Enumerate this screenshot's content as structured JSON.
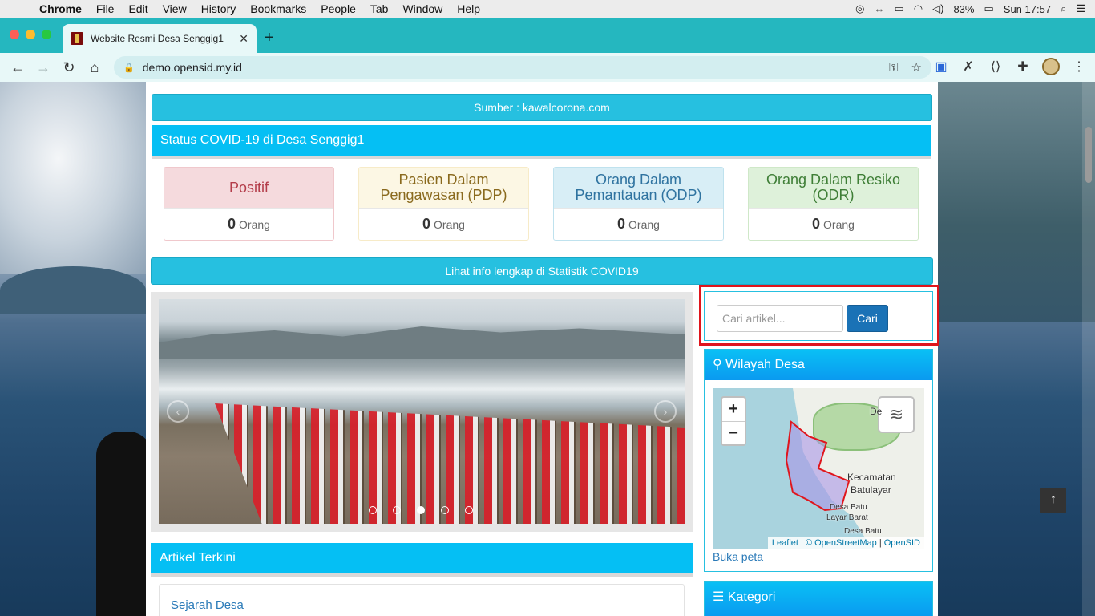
{
  "menubar": {
    "app": "Chrome",
    "items": [
      "File",
      "Edit",
      "View",
      "History",
      "Bookmarks",
      "People",
      "Tab",
      "Window",
      "Help"
    ],
    "battery": "83%",
    "clock": "Sun 17:57"
  },
  "browser": {
    "tab_title": "Website Resmi Desa Senggig1",
    "url": "demo.opensid.my.id"
  },
  "page": {
    "source_bar": "Sumber : kawalcorona.com",
    "covid_title": "Status COVID-19 di Desa Senggig1",
    "stats": [
      {
        "label": "Positif",
        "value": "0",
        "unit": "Orang"
      },
      {
        "label": "Pasien Dalam Pengawasan (PDP)",
        "value": "0",
        "unit": "Orang"
      },
      {
        "label": "Orang Dalam Pemantauan (ODP)",
        "value": "0",
        "unit": "Orang"
      },
      {
        "label": "Orang Dalam Resiko (ODR)",
        "value": "0",
        "unit": "Orang"
      }
    ],
    "info_link": "Lihat info lengkap di Statistik COVID19",
    "slider": {
      "total_slides": 5,
      "active_slide": 3
    },
    "articles_title": "Artikel Terkini",
    "article_first": "Sejarah Desa"
  },
  "sidebar": {
    "search_placeholder": "Cari artikel...",
    "search_button": "Cari",
    "wilayah_title": "Wilayah Desa",
    "map": {
      "zoom_in": "+",
      "zoom_out": "−",
      "label_kecamatan": "Kecamatan",
      "label_batulayar": "Batulayar",
      "label_desa1": "Desa Batu",
      "label_desa2": "Layar Barat",
      "label_desa3": "Desa Batu",
      "label_de": "De",
      "attrib_leaflet": "Leaflet",
      "attrib_osm": "© OpenStreetMap",
      "attrib_opensid": "OpenSID"
    },
    "buka_peta": "Buka peta",
    "kategori_title": "Kategori"
  },
  "colors": {
    "accent": "#05bff4",
    "button": "#1a72b6",
    "highlight": "#e0151c"
  }
}
